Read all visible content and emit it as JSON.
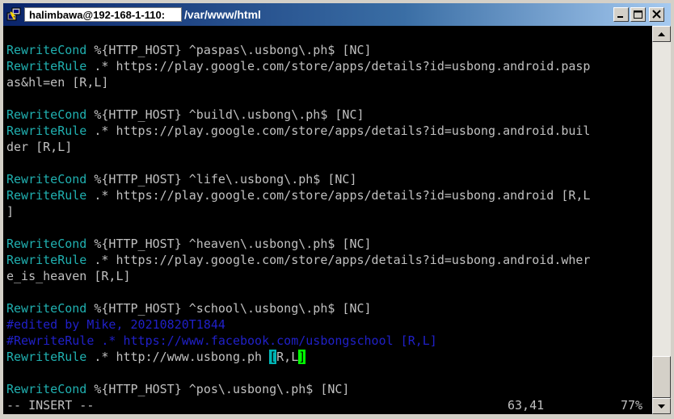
{
  "titlebar": {
    "host": "halimbawa@192-168-1-110:",
    "path": "/var/www/html"
  },
  "editor": {
    "lines": [
      {
        "kind": "blank"
      },
      {
        "kind": "cmd",
        "kw": "RewriteCond",
        "rest": " %{HTTP_HOST} ^paspas\\.usbong\\.ph$ [NC]"
      },
      {
        "kind": "cmd",
        "kw": "RewriteRule",
        "rest": " .* https://play.google.com/store/apps/details?id=usbong.android.pasp"
      },
      {
        "kind": "plain",
        "text": "as&hl=en [R,L]"
      },
      {
        "kind": "blank"
      },
      {
        "kind": "cmd",
        "kw": "RewriteCond",
        "rest": " %{HTTP_HOST} ^build\\.usbong\\.ph$ [NC]"
      },
      {
        "kind": "cmd",
        "kw": "RewriteRule",
        "rest": " .* https://play.google.com/store/apps/details?id=usbong.android.buil"
      },
      {
        "kind": "plain",
        "text": "der [R,L]"
      },
      {
        "kind": "blank"
      },
      {
        "kind": "cmd",
        "kw": "RewriteCond",
        "rest": " %{HTTP_HOST} ^life\\.usbong\\.ph$ [NC]"
      },
      {
        "kind": "cmd",
        "kw": "RewriteRule",
        "rest": " .* https://play.google.com/store/apps/details?id=usbong.android [R,L"
      },
      {
        "kind": "plain",
        "text": "]"
      },
      {
        "kind": "blank"
      },
      {
        "kind": "cmd",
        "kw": "RewriteCond",
        "rest": " %{HTTP_HOST} ^heaven\\.usbong\\.ph$ [NC]"
      },
      {
        "kind": "cmd",
        "kw": "RewriteRule",
        "rest": " .* https://play.google.com/store/apps/details?id=usbong.android.wher"
      },
      {
        "kind": "plain",
        "text": "e_is_heaven [R,L]"
      },
      {
        "kind": "blank"
      },
      {
        "kind": "cmd",
        "kw": "RewriteCond",
        "rest": " %{HTTP_HOST} ^school\\.usbong\\.ph$ [NC]"
      },
      {
        "kind": "comment",
        "text": "#edited by Mike, 20210820T1844"
      },
      {
        "kind": "comment",
        "text": "#RewriteRule .* https://www.facebook.com/usbongschool [R,L]"
      },
      {
        "kind": "cursorline",
        "kw": "RewriteRule",
        "before": " .* http://www.usbong.ph ",
        "c1": "[",
        "mid": "R,L",
        "c2": "]"
      },
      {
        "kind": "blank"
      },
      {
        "kind": "cmd",
        "kw": "RewriteCond",
        "rest": " %{HTTP_HOST} ^pos\\.usbong\\.ph$ [NC]"
      }
    ]
  },
  "statusbar": {
    "mode": "-- INSERT --",
    "position": "63,41",
    "percent": "77%"
  },
  "colors": {
    "keyword": "#20b0b0",
    "comment": "#2020c8",
    "cursor_match": "#00b4b4",
    "cursor": "#00ff00"
  }
}
